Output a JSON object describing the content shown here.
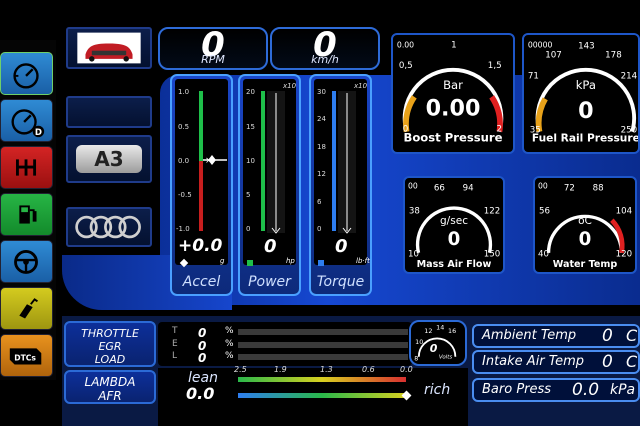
{
  "readouts": {
    "rpm": {
      "value": "0",
      "unit": "RPM"
    },
    "speed": {
      "value": "0",
      "unit": "km/h"
    }
  },
  "bars": [
    {
      "name": "Accel",
      "value": "+0.0",
      "unit": "g",
      "multiplier": "",
      "ticks": [
        "1.0",
        "0.5",
        "0.0",
        "-0.5",
        "-1.0"
      ],
      "color": "#1ec04a"
    },
    {
      "name": "Power",
      "value": "0",
      "unit": "hp",
      "multiplier": "x10",
      "ticks": [
        "20",
        "15",
        "10",
        "5",
        "0"
      ],
      "color": "#1ec04a"
    },
    {
      "name": "Torque",
      "value": "0",
      "unit": "lb·ft",
      "multiplier": "x10",
      "ticks": [
        "30",
        "24",
        "18",
        "12",
        "6",
        "0"
      ],
      "color": "#2e7ef0"
    }
  ],
  "gauges": {
    "boost": {
      "title": "Boost Pressure",
      "unit": "Bar",
      "value": "0.00",
      "min_label": "0.00",
      "ticks": [
        "0",
        "0,5",
        "1",
        "1,5",
        "2"
      ]
    },
    "fuel_rail": {
      "title": "Fuel Rail Pressure",
      "unit": "kPa",
      "value": "0",
      "min_label": "00000",
      "ticks": [
        "35",
        "71",
        "107",
        "143",
        "178",
        "214",
        "250"
      ]
    },
    "maf": {
      "title": "Mass Air Flow",
      "unit": "g/sec",
      "value": "0",
      "min_label": "00",
      "ticks": [
        "10",
        "38",
        "66",
        "94",
        "122",
        "150"
      ]
    },
    "water": {
      "title": "Water Temp",
      "unit": "oC",
      "value": "0",
      "min_label": "00",
      "ticks": [
        "40",
        "56",
        "72",
        "88",
        "104",
        "120"
      ]
    }
  },
  "left_menu": [
    {
      "icon": "speedometer-icon",
      "color": "#2f8bd4"
    },
    {
      "icon": "speedometer-d-icon",
      "color": "#2f8bd4"
    },
    {
      "icon": "gear-shift-icon",
      "color": "#c01c1c"
    },
    {
      "icon": "fuel-pump-icon",
      "color": "#1ea93a"
    },
    {
      "icon": "steering-wheel-icon",
      "color": "#2f8bd4"
    },
    {
      "icon": "fuel-nozzle-icon",
      "color": "#c8c21a"
    },
    {
      "icon": "dtcs-engine-icon",
      "label": "DTCs",
      "color": "#e08a1a"
    }
  ],
  "thumbnails": {
    "model_badge": "A3"
  },
  "throttle": {
    "labels": [
      "THROTTLE",
      "EGR",
      "LOAD"
    ],
    "rows": [
      {
        "letter": "T",
        "value": "0",
        "unit": "%"
      },
      {
        "letter": "E",
        "value": "0",
        "unit": "%"
      },
      {
        "letter": "L",
        "value": "0",
        "unit": "%"
      }
    ]
  },
  "lambda": {
    "labels": [
      "LAMBDA",
      "AFR"
    ],
    "lean_label": "lean",
    "rich_label": "rich",
    "value": "0.0",
    "scale": [
      "2.5",
      "1.9",
      "1.3",
      "0.6",
      "0.0"
    ]
  },
  "volts": {
    "value": "0",
    "unit": "Volts",
    "ticks": [
      "8",
      "10",
      "12",
      "14",
      "16"
    ]
  },
  "env": [
    {
      "label": "Ambient Temp",
      "value": "0",
      "unit": "C"
    },
    {
      "label": "Intake Air Temp",
      "value": "0",
      "unit": "C"
    },
    {
      "label": "Baro Press",
      "value": "0.0",
      "unit": "kPa"
    }
  ]
}
